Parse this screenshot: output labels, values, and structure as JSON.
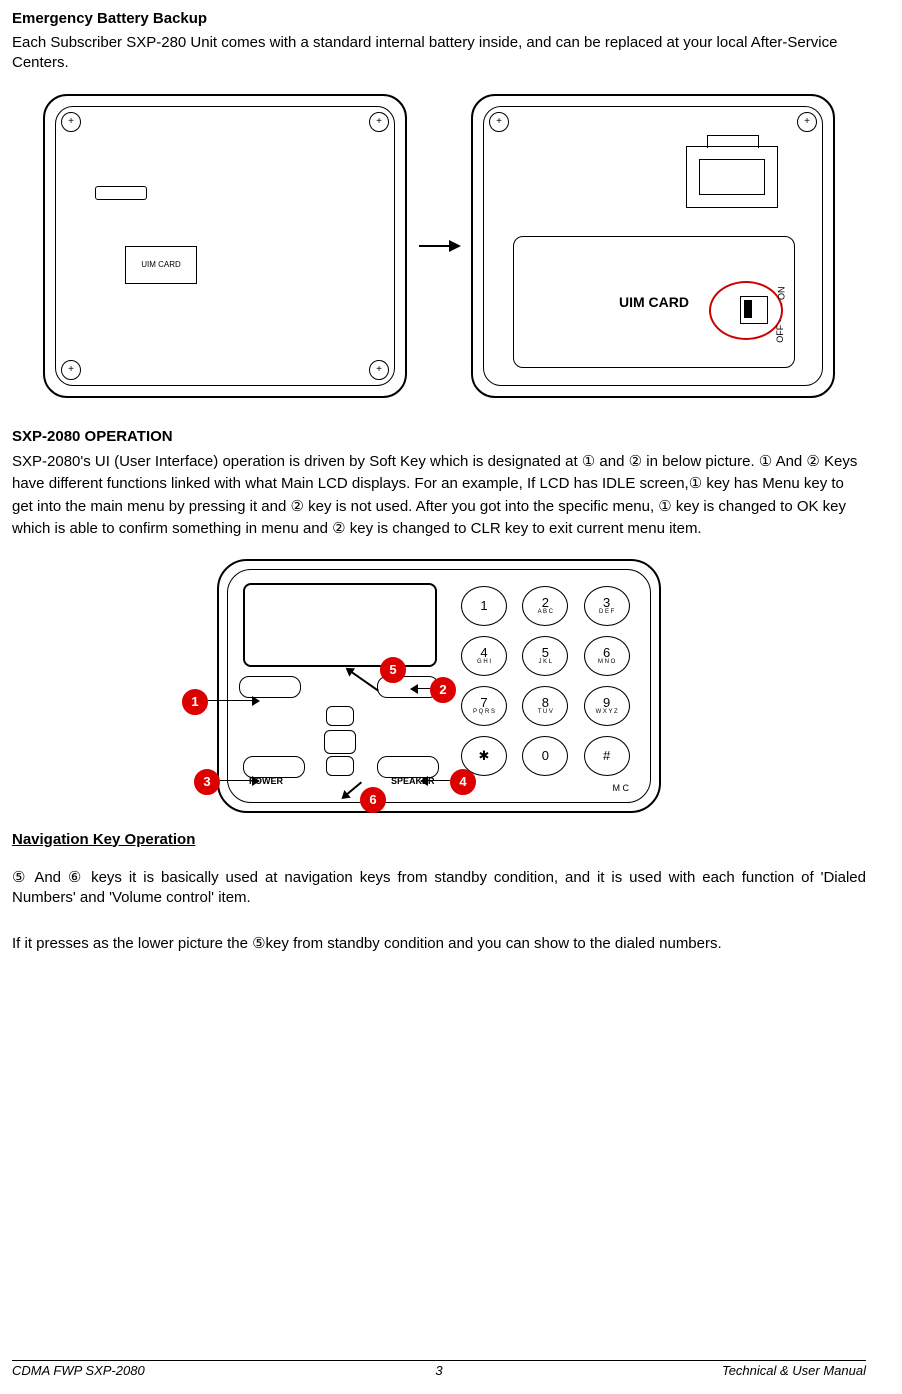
{
  "headings": {
    "battery": "Emergency Battery Backup",
    "operation": "SXP-2080 OPERATION",
    "navkey": "Navigation Key Operation"
  },
  "paragraphs": {
    "battery_body": "Each Subscriber SXP-280 Unit comes with a standard internal battery inside, and can be replaced at your local After-Service Centers.",
    "operation_body": "SXP-2080's UI (User Interface) operation is driven by Soft Key which is designated at ① and ② in below picture. ① And ② Keys have different functions linked with what Main LCD displays. For an example, If LCD has IDLE screen,① key has Menu key to get into the main menu by pressing it and ② key is not used. After you got into the specific menu, ① key is changed to OK key which is able to confirm something in menu and ② key is changed to CLR key to exit current menu item.",
    "nav_body1": "⑤ And ⑥ keys it is basically used at navigation keys from standby condition, and it is used with each function of 'Dialed Numbers' and 'Volume control' item.",
    "nav_body2": "If it presses as the lower picture the  ⑤key from standby condition and you can show to the dialed numbers."
  },
  "figure1": {
    "uim_small": "UIM CARD",
    "uim_panel": "UIM CARD",
    "off": "OFF ·",
    "on": "· ON"
  },
  "figure2": {
    "power": "POWER",
    "speaker": "SPEAKER",
    "mic": "M C",
    "keys": [
      {
        "main": "1",
        "sub": ""
      },
      {
        "main": "2",
        "sub": "A B C"
      },
      {
        "main": "3",
        "sub": "D E F"
      },
      {
        "main": "4",
        "sub": "G H I"
      },
      {
        "main": "5",
        "sub": "J K L"
      },
      {
        "main": "6",
        "sub": "M N O"
      },
      {
        "main": "7",
        "sub": "P Q R S"
      },
      {
        "main": "8",
        "sub": "T U V"
      },
      {
        "main": "9",
        "sub": "W X Y Z"
      },
      {
        "main": "✱",
        "sub": ""
      },
      {
        "main": "0",
        "sub": ""
      },
      {
        "main": "#",
        "sub": ""
      }
    ],
    "callouts": {
      "c1": "1",
      "c2": "2",
      "c3": "3",
      "c4": "4",
      "c5": "5",
      "c6": "6"
    }
  },
  "footer": {
    "left": "CDMA FWP SXP-2080",
    "center": "3",
    "right": "Technical & User Manual"
  }
}
